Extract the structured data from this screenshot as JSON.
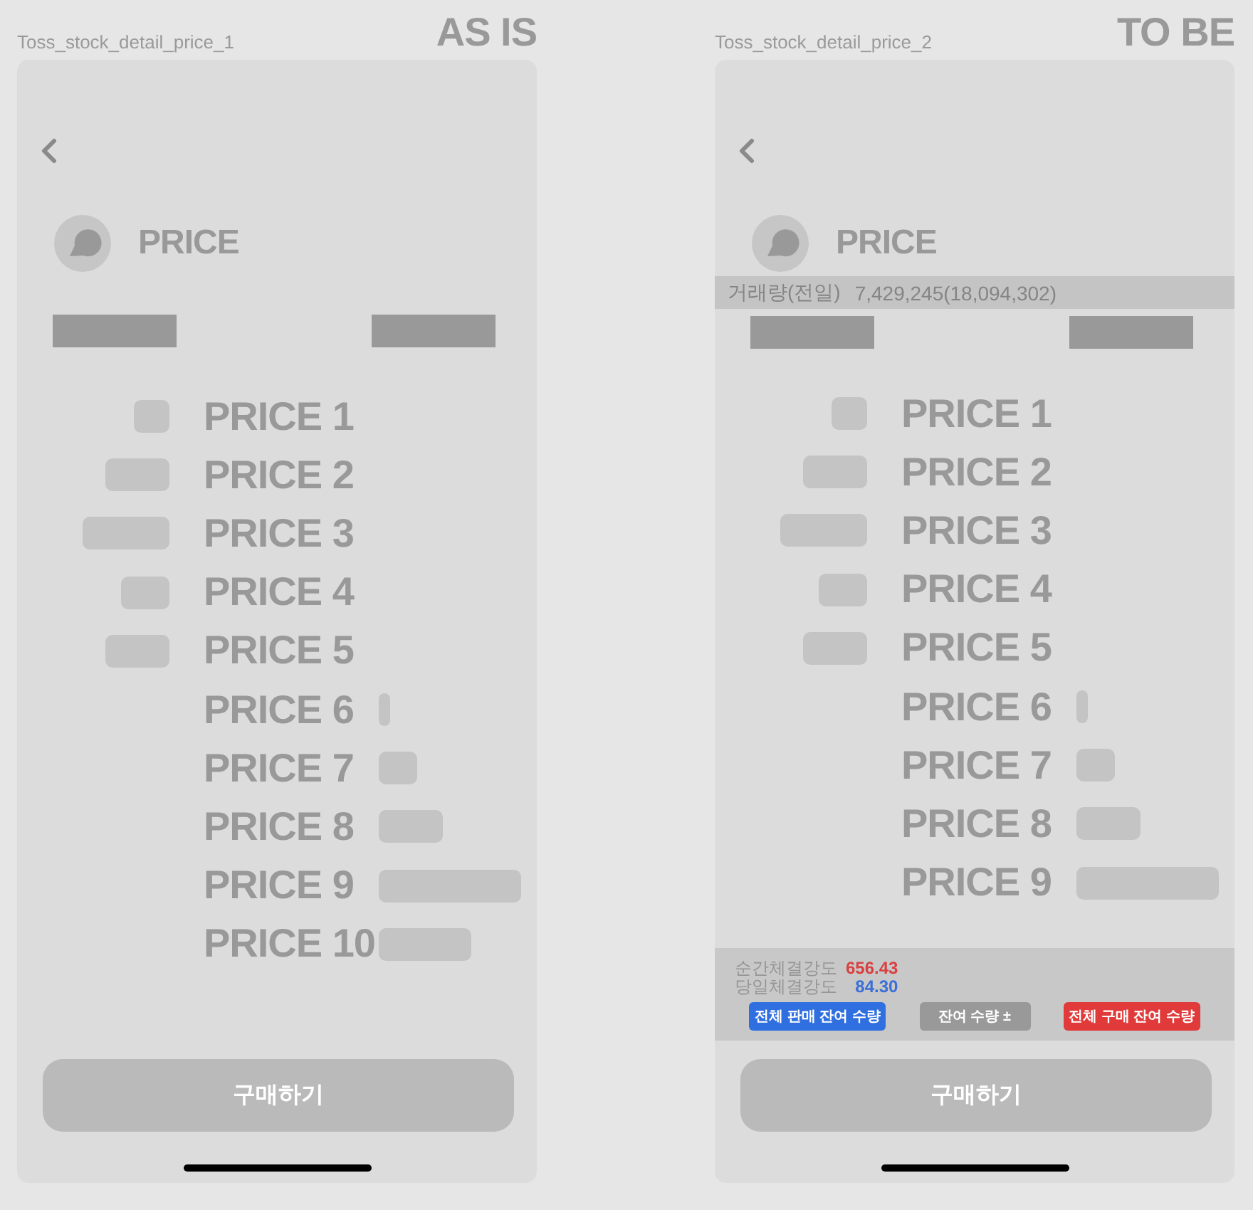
{
  "screens": [
    {
      "frame_label": "Toss_stock_detail_price_1",
      "tag": "AS IS",
      "header": {
        "title": "PRICE"
      },
      "price_rows": [
        {
          "label": "PRICE 1",
          "kind": "sell"
        },
        {
          "label": "PRICE 2",
          "kind": "sell"
        },
        {
          "label": "PRICE 3",
          "kind": "sell"
        },
        {
          "label": "PRICE 4",
          "kind": "sell"
        },
        {
          "label": "PRICE 5",
          "kind": "sell"
        },
        {
          "label": "PRICE 6",
          "kind": "buy"
        },
        {
          "label": "PRICE 7",
          "kind": "buy"
        },
        {
          "label": "PRICE 8",
          "kind": "buy"
        },
        {
          "label": "PRICE 9",
          "kind": "buy"
        },
        {
          "label": "PRICE 10",
          "kind": "buy"
        }
      ],
      "buy_button": "구매하기"
    },
    {
      "frame_label": "Toss_stock_detail_price_2",
      "tag": "TO BE",
      "header": {
        "title": "PRICE"
      },
      "volume_info": {
        "label": "거래량(전일)",
        "value": "7,429,245(18,094,302)"
      },
      "price_rows": [
        {
          "label": "PRICE 1",
          "kind": "sell"
        },
        {
          "label": "PRICE 2",
          "kind": "sell"
        },
        {
          "label": "PRICE 3",
          "kind": "sell"
        },
        {
          "label": "PRICE 4",
          "kind": "sell"
        },
        {
          "label": "PRICE 5",
          "kind": "sell"
        },
        {
          "label": "PRICE 6",
          "kind": "buy"
        },
        {
          "label": "PRICE 7",
          "kind": "buy"
        },
        {
          "label": "PRICE 8",
          "kind": "buy"
        },
        {
          "label": "PRICE 9",
          "kind": "buy"
        }
      ],
      "strength_panel": {
        "lines": [
          {
            "label": "순간체결강도",
            "value": "656.43",
            "color": "#d94040"
          },
          {
            "label": "당일체결강도",
            "value": "84.30",
            "color": "#3a6fd8"
          }
        ],
        "buttons": [
          {
            "label": "전체 판매 잔여 수량",
            "color": "#2f6fe0"
          },
          {
            "label": "잔여 수량 ±",
            "color": "#999999"
          },
          {
            "label": "전체 구매 잔여 수량",
            "color": "#e03a3a"
          }
        ]
      },
      "buy_button": "구매하기"
    }
  ]
}
